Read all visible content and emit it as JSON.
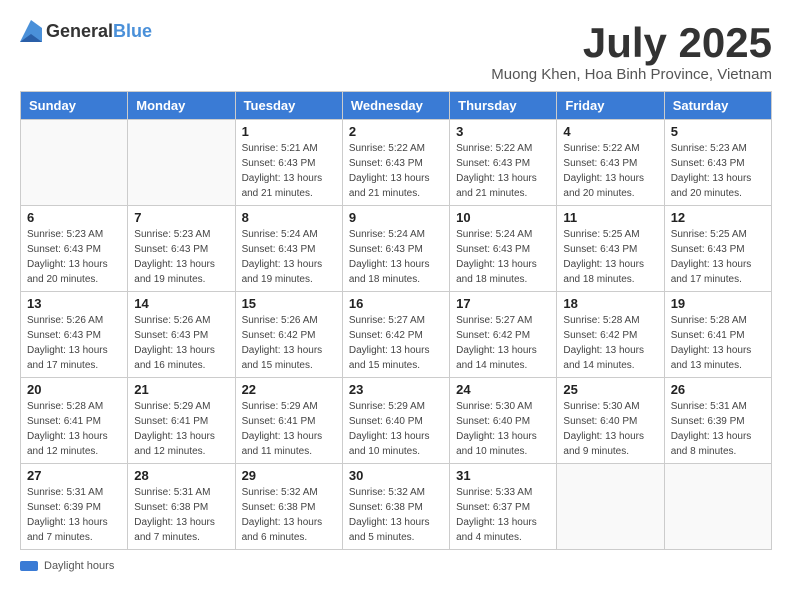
{
  "logo": {
    "general": "General",
    "blue": "Blue"
  },
  "title": "July 2025",
  "location": "Muong Khen, Hoa Binh Province, Vietnam",
  "days_of_week": [
    "Sunday",
    "Monday",
    "Tuesday",
    "Wednesday",
    "Thursday",
    "Friday",
    "Saturday"
  ],
  "footer_label": "Daylight hours",
  "weeks": [
    [
      {
        "day": "",
        "sunrise": "",
        "sunset": "",
        "daylight": ""
      },
      {
        "day": "",
        "sunrise": "",
        "sunset": "",
        "daylight": ""
      },
      {
        "day": "1",
        "sunrise": "Sunrise: 5:21 AM",
        "sunset": "Sunset: 6:43 PM",
        "daylight": "Daylight: 13 hours and 21 minutes."
      },
      {
        "day": "2",
        "sunrise": "Sunrise: 5:22 AM",
        "sunset": "Sunset: 6:43 PM",
        "daylight": "Daylight: 13 hours and 21 minutes."
      },
      {
        "day": "3",
        "sunrise": "Sunrise: 5:22 AM",
        "sunset": "Sunset: 6:43 PM",
        "daylight": "Daylight: 13 hours and 21 minutes."
      },
      {
        "day": "4",
        "sunrise": "Sunrise: 5:22 AM",
        "sunset": "Sunset: 6:43 PM",
        "daylight": "Daylight: 13 hours and 20 minutes."
      },
      {
        "day": "5",
        "sunrise": "Sunrise: 5:23 AM",
        "sunset": "Sunset: 6:43 PM",
        "daylight": "Daylight: 13 hours and 20 minutes."
      }
    ],
    [
      {
        "day": "6",
        "sunrise": "Sunrise: 5:23 AM",
        "sunset": "Sunset: 6:43 PM",
        "daylight": "Daylight: 13 hours and 20 minutes."
      },
      {
        "day": "7",
        "sunrise": "Sunrise: 5:23 AM",
        "sunset": "Sunset: 6:43 PM",
        "daylight": "Daylight: 13 hours and 19 minutes."
      },
      {
        "day": "8",
        "sunrise": "Sunrise: 5:24 AM",
        "sunset": "Sunset: 6:43 PM",
        "daylight": "Daylight: 13 hours and 19 minutes."
      },
      {
        "day": "9",
        "sunrise": "Sunrise: 5:24 AM",
        "sunset": "Sunset: 6:43 PM",
        "daylight": "Daylight: 13 hours and 18 minutes."
      },
      {
        "day": "10",
        "sunrise": "Sunrise: 5:24 AM",
        "sunset": "Sunset: 6:43 PM",
        "daylight": "Daylight: 13 hours and 18 minutes."
      },
      {
        "day": "11",
        "sunrise": "Sunrise: 5:25 AM",
        "sunset": "Sunset: 6:43 PM",
        "daylight": "Daylight: 13 hours and 18 minutes."
      },
      {
        "day": "12",
        "sunrise": "Sunrise: 5:25 AM",
        "sunset": "Sunset: 6:43 PM",
        "daylight": "Daylight: 13 hours and 17 minutes."
      }
    ],
    [
      {
        "day": "13",
        "sunrise": "Sunrise: 5:26 AM",
        "sunset": "Sunset: 6:43 PM",
        "daylight": "Daylight: 13 hours and 17 minutes."
      },
      {
        "day": "14",
        "sunrise": "Sunrise: 5:26 AM",
        "sunset": "Sunset: 6:43 PM",
        "daylight": "Daylight: 13 hours and 16 minutes."
      },
      {
        "day": "15",
        "sunrise": "Sunrise: 5:26 AM",
        "sunset": "Sunset: 6:42 PM",
        "daylight": "Daylight: 13 hours and 15 minutes."
      },
      {
        "day": "16",
        "sunrise": "Sunrise: 5:27 AM",
        "sunset": "Sunset: 6:42 PM",
        "daylight": "Daylight: 13 hours and 15 minutes."
      },
      {
        "day": "17",
        "sunrise": "Sunrise: 5:27 AM",
        "sunset": "Sunset: 6:42 PM",
        "daylight": "Daylight: 13 hours and 14 minutes."
      },
      {
        "day": "18",
        "sunrise": "Sunrise: 5:28 AM",
        "sunset": "Sunset: 6:42 PM",
        "daylight": "Daylight: 13 hours and 14 minutes."
      },
      {
        "day": "19",
        "sunrise": "Sunrise: 5:28 AM",
        "sunset": "Sunset: 6:41 PM",
        "daylight": "Daylight: 13 hours and 13 minutes."
      }
    ],
    [
      {
        "day": "20",
        "sunrise": "Sunrise: 5:28 AM",
        "sunset": "Sunset: 6:41 PM",
        "daylight": "Daylight: 13 hours and 12 minutes."
      },
      {
        "day": "21",
        "sunrise": "Sunrise: 5:29 AM",
        "sunset": "Sunset: 6:41 PM",
        "daylight": "Daylight: 13 hours and 12 minutes."
      },
      {
        "day": "22",
        "sunrise": "Sunrise: 5:29 AM",
        "sunset": "Sunset: 6:41 PM",
        "daylight": "Daylight: 13 hours and 11 minutes."
      },
      {
        "day": "23",
        "sunrise": "Sunrise: 5:29 AM",
        "sunset": "Sunset: 6:40 PM",
        "daylight": "Daylight: 13 hours and 10 minutes."
      },
      {
        "day": "24",
        "sunrise": "Sunrise: 5:30 AM",
        "sunset": "Sunset: 6:40 PM",
        "daylight": "Daylight: 13 hours and 10 minutes."
      },
      {
        "day": "25",
        "sunrise": "Sunrise: 5:30 AM",
        "sunset": "Sunset: 6:40 PM",
        "daylight": "Daylight: 13 hours and 9 minutes."
      },
      {
        "day": "26",
        "sunrise": "Sunrise: 5:31 AM",
        "sunset": "Sunset: 6:39 PM",
        "daylight": "Daylight: 13 hours and 8 minutes."
      }
    ],
    [
      {
        "day": "27",
        "sunrise": "Sunrise: 5:31 AM",
        "sunset": "Sunset: 6:39 PM",
        "daylight": "Daylight: 13 hours and 7 minutes."
      },
      {
        "day": "28",
        "sunrise": "Sunrise: 5:31 AM",
        "sunset": "Sunset: 6:38 PM",
        "daylight": "Daylight: 13 hours and 7 minutes."
      },
      {
        "day": "29",
        "sunrise": "Sunrise: 5:32 AM",
        "sunset": "Sunset: 6:38 PM",
        "daylight": "Daylight: 13 hours and 6 minutes."
      },
      {
        "day": "30",
        "sunrise": "Sunrise: 5:32 AM",
        "sunset": "Sunset: 6:38 PM",
        "daylight": "Daylight: 13 hours and 5 minutes."
      },
      {
        "day": "31",
        "sunrise": "Sunrise: 5:33 AM",
        "sunset": "Sunset: 6:37 PM",
        "daylight": "Daylight: 13 hours and 4 minutes."
      },
      {
        "day": "",
        "sunrise": "",
        "sunset": "",
        "daylight": ""
      },
      {
        "day": "",
        "sunrise": "",
        "sunset": "",
        "daylight": ""
      }
    ]
  ]
}
